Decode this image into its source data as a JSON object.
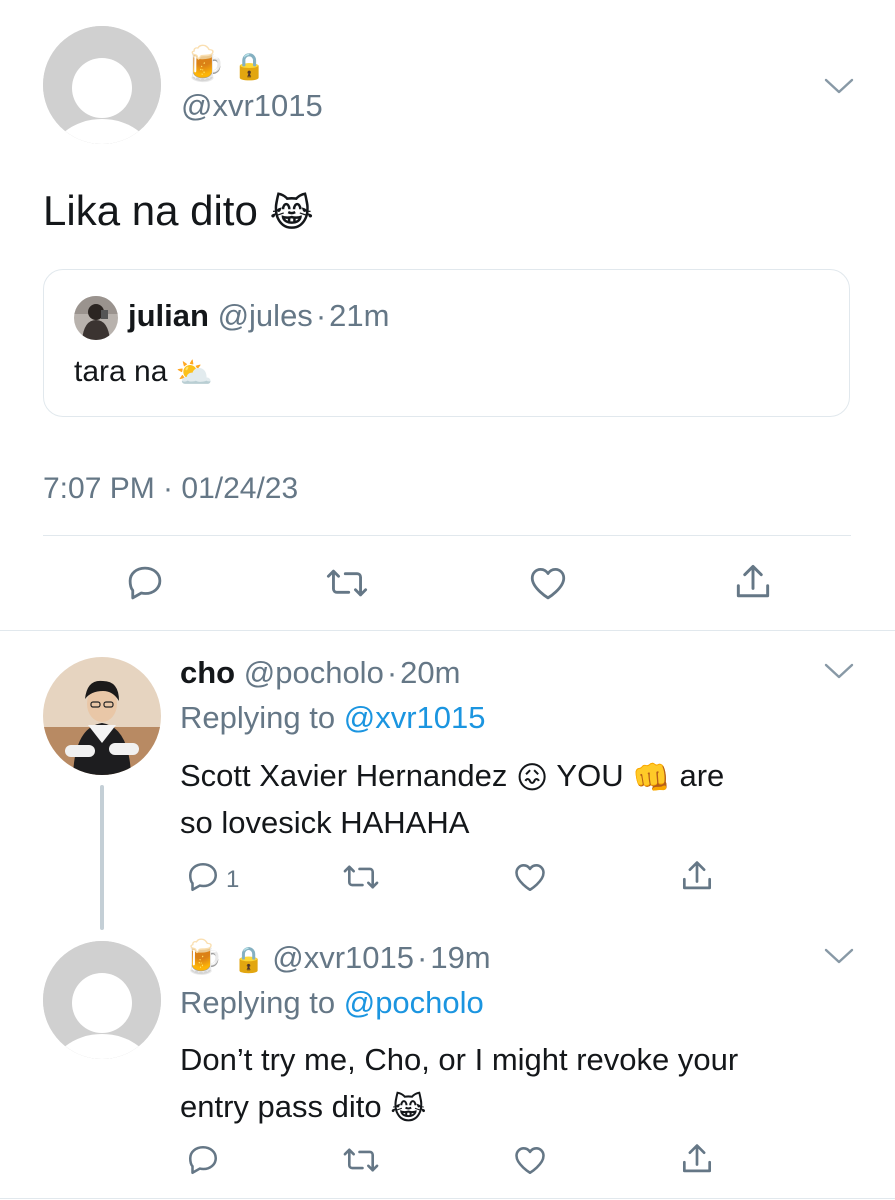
{
  "main_tweet": {
    "emojis": "🍺🔒",
    "handle": "@xvr1015",
    "text": "Lika na dito",
    "text_emoji": "😹",
    "quote": {
      "name": "julian",
      "handle": "@jules",
      "sep": "·",
      "time": "21m",
      "text": "tara na",
      "text_emoji": "⛅"
    },
    "timestamp": "7:07 PM · 01/24/23"
  },
  "reply1": {
    "name": "cho",
    "handle": "@pocholo",
    "sep": "·",
    "time": "20m",
    "replying_prefix": "Replying to",
    "replying_to": "@xvr1015",
    "text_part1": "Scott Xavier Hernandez",
    "emoji1": "😖",
    "text_part2": "YOU",
    "emoji2": "👊",
    "text_part3": "are",
    "text_line2": "so lovesick HAHAHA",
    "reply_count": "1"
  },
  "reply2": {
    "emojis": "🍺🔒",
    "handle": "@xvr1015",
    "sep": "·",
    "time": "19m",
    "replying_prefix": "Replying to",
    "replying_to": "@pocholo",
    "text_line1": "Don’t try me, Cho, or I might revoke your",
    "text_line2": "entry pass dito",
    "text_emoji": "😹"
  },
  "colors": {
    "text": "#14171a",
    "secondary": "#657786",
    "link": "#1b95e0",
    "border": "#e1e8ed"
  }
}
